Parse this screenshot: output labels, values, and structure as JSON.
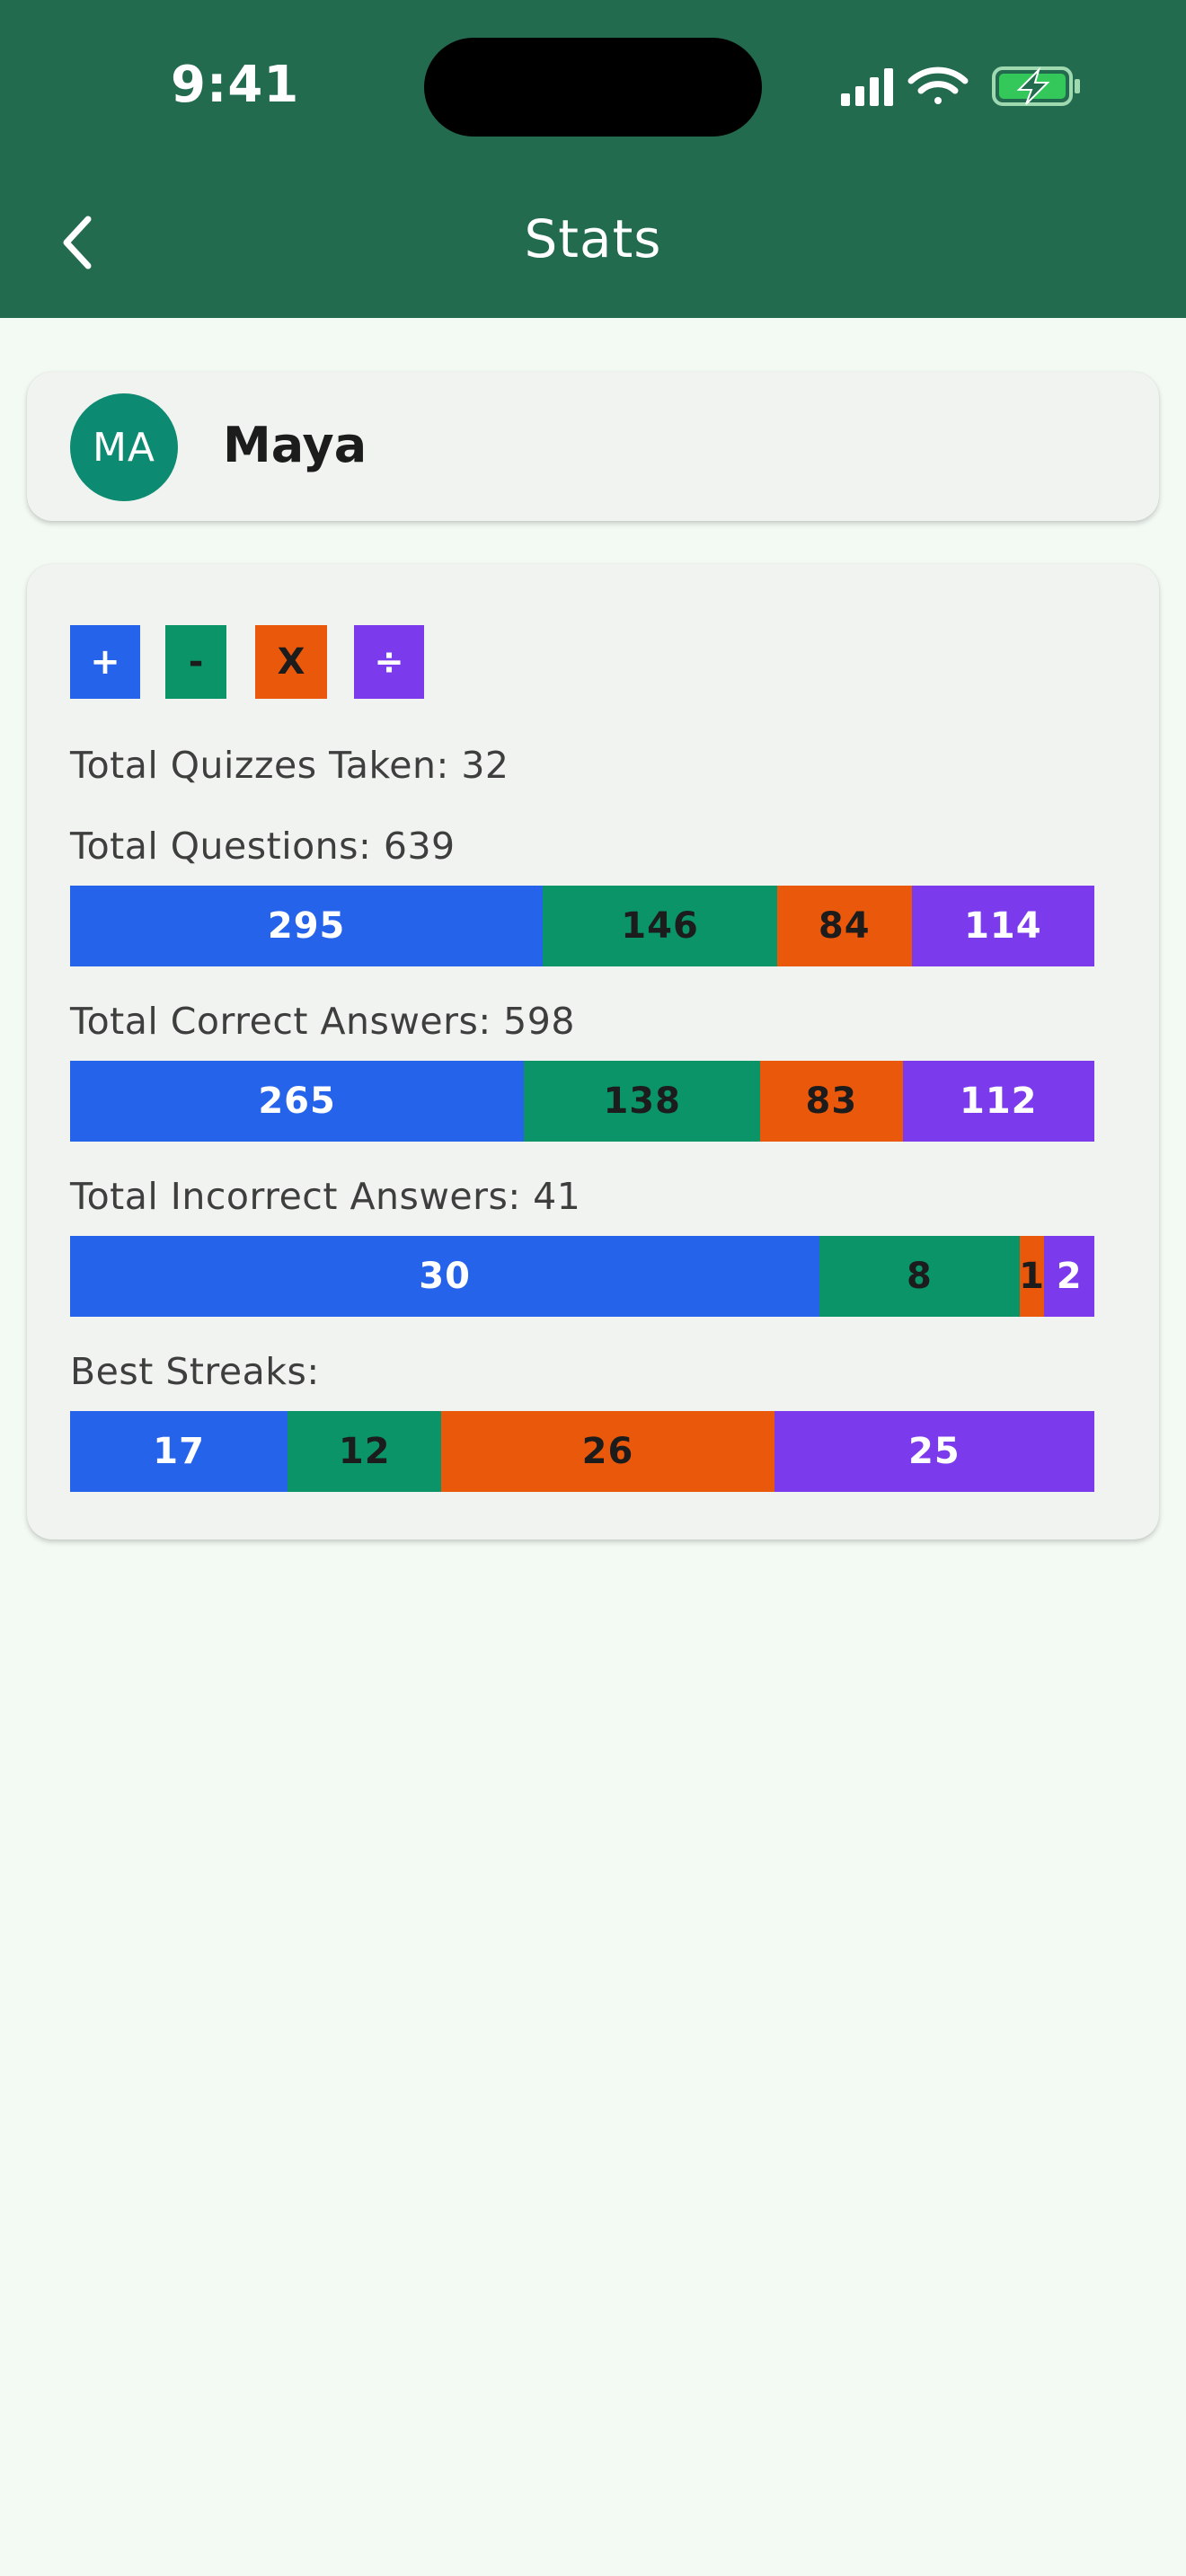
{
  "status_bar": {
    "time": "9:41"
  },
  "app_bar": {
    "title": "Stats"
  },
  "user": {
    "initials": "MA",
    "name": "Maya"
  },
  "colors": {
    "add": "#2563eb",
    "subtract": "#0a9468",
    "multiply": "#ea580c",
    "divide": "#7c3aed",
    "app_bar": "#236b4e"
  },
  "operations": [
    {
      "symbol": "+",
      "icon": "plus-icon"
    },
    {
      "symbol": "-",
      "icon": "minus-icon"
    },
    {
      "symbol": "X",
      "icon": "multiply-icon"
    },
    {
      "symbol": "÷",
      "icon": "divide-icon"
    }
  ],
  "stats": {
    "quizzes_label": "Total Quizzes Taken: 32",
    "questions_label": "Total Questions: 639",
    "correct_label": "Total Correct Answers: 598",
    "incorrect_label": "Total Incorrect Answers: 41",
    "streaks_label": "Best Streaks:"
  },
  "chart_data": {
    "type": "bar",
    "categories": [
      "+",
      "-",
      "X",
      "÷"
    ],
    "series": [
      {
        "name": "Total Questions",
        "values": [
          295,
          146,
          84,
          114
        ]
      },
      {
        "name": "Total Correct Answers",
        "values": [
          265,
          138,
          83,
          112
        ]
      },
      {
        "name": "Total Incorrect Answers",
        "values": [
          30,
          8,
          1,
          2
        ]
      },
      {
        "name": "Best Streaks",
        "values": [
          17,
          12,
          26,
          25
        ]
      }
    ]
  }
}
